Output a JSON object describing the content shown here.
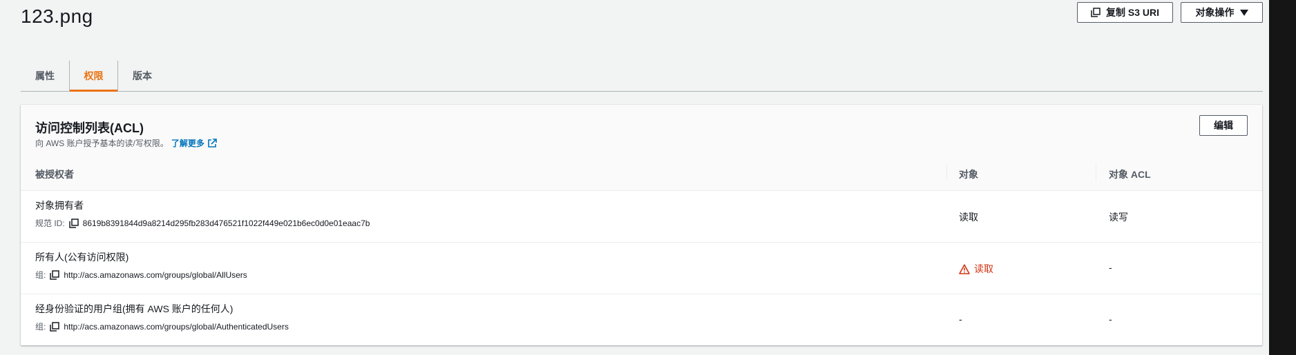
{
  "page": {
    "title": "123.png"
  },
  "header_buttons": {
    "copy_uri": "复制 S3 URI",
    "object_actions": "对象操作"
  },
  "tabs": [
    {
      "label": "属性",
      "active": false
    },
    {
      "label": "权限",
      "active": true
    },
    {
      "label": "版本",
      "active": false
    }
  ],
  "acl": {
    "title": "访问控制列表(ACL)",
    "description": "向 AWS 账户授予基本的读/写权限。",
    "learn_more": "了解更多",
    "edit_button": "编辑",
    "columns": [
      "被授权者",
      "对象",
      "对象 ACL"
    ],
    "rows": [
      {
        "grantee": "对象拥有者",
        "sub_label": "规范 ID:",
        "sub_value": "8619b8391844d9a8214d295fb283d476521f1022f449e021b6ec0d0e01eaac7b",
        "object": "读取",
        "object_acl": "读写",
        "warning": false
      },
      {
        "grantee": "所有人(公有访问权限)",
        "sub_label": "组:",
        "sub_value": "http://acs.amazonaws.com/groups/global/AllUsers",
        "object": "读取",
        "object_acl": "-",
        "warning": true
      },
      {
        "grantee": "经身份验证的用户组(拥有 AWS 账户的任何人)",
        "sub_label": "组:",
        "sub_value": "http://acs.amazonaws.com/groups/global/AuthenticatedUsers",
        "object": "-",
        "object_acl": "-",
        "warning": false
      }
    ]
  },
  "colors": {
    "accent": "#ec7211",
    "link": "#0073bb",
    "warning": "#d13212"
  }
}
